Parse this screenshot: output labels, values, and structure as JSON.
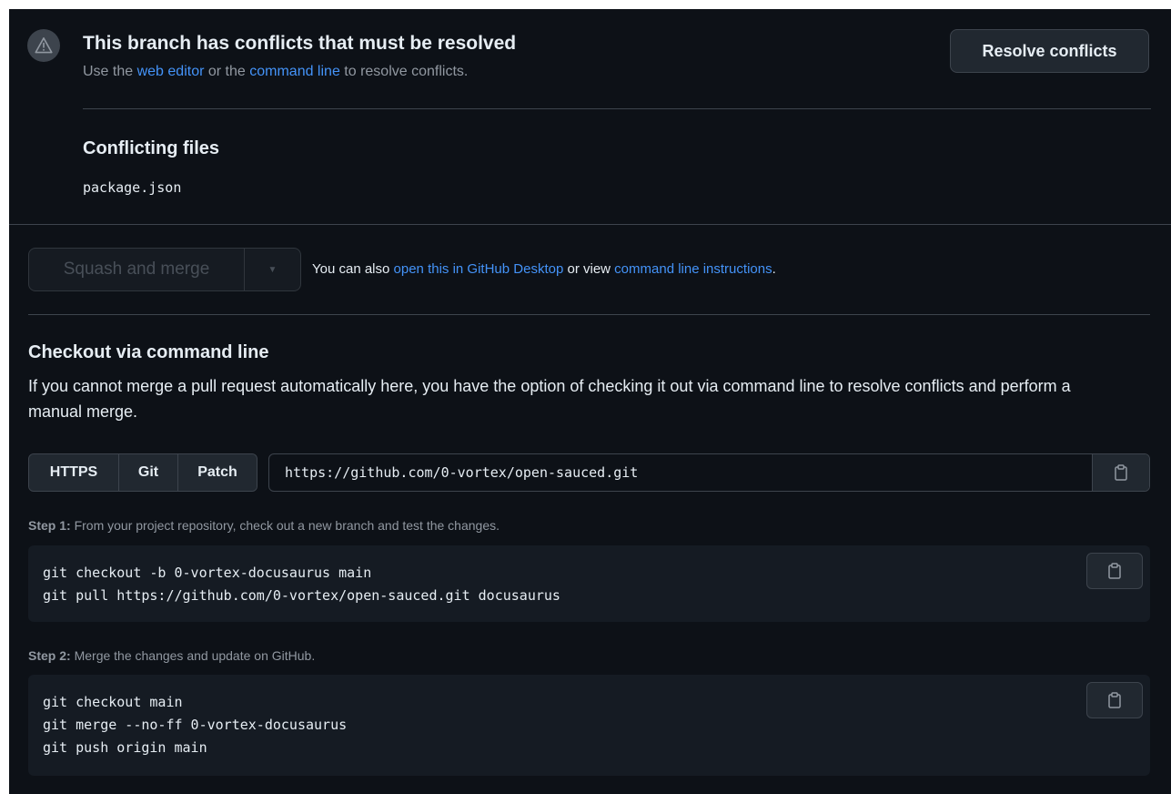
{
  "conflict": {
    "title": "This branch has conflicts that must be resolved",
    "sub_prefix": "Use the ",
    "web_editor_link": "web editor",
    "sub_middle": " or the ",
    "command_line_link": "command line",
    "sub_suffix": " to resolve conflicts.",
    "resolve_button": "Resolve conflicts",
    "files_heading": "Conflicting files",
    "files": [
      "package.json"
    ]
  },
  "merge": {
    "button_label": "Squash and merge",
    "caret": "▼",
    "note_prefix": "You can also ",
    "desktop_link": "open this in GitHub Desktop",
    "note_middle": " or view ",
    "instructions_link": "command line instructions",
    "note_suffix": "."
  },
  "checkout": {
    "title": "Checkout via command line",
    "description": "If you cannot merge a pull request automatically here, you have the option of checking it out via command line to resolve conflicts and perform a manual merge.",
    "protocols": [
      "HTTPS",
      "Git",
      "Patch"
    ],
    "clone_url": "https://github.com/0-vortex/open-sauced.git",
    "step1_label": "Step 1:",
    "step1_text": " From your project repository, check out a new branch and test the changes.",
    "step1_lines": [
      "git checkout -b 0-vortex-docusaurus main",
      "git pull https://github.com/0-vortex/open-sauced.git docusaurus"
    ],
    "step2_label": "Step 2:",
    "step2_text": " Merge the changes and update on GitHub.",
    "step2_lines": [
      "git checkout main",
      "git merge --no-ff 0-vortex-docusaurus",
      "git push origin main"
    ]
  },
  "icons": {
    "warning": "alert-icon",
    "copy": "clipboard-icon"
  },
  "colors": {
    "background": "#0d1117",
    "link": "#4493f8",
    "muted": "#9198a1",
    "border": "#3d444d"
  }
}
